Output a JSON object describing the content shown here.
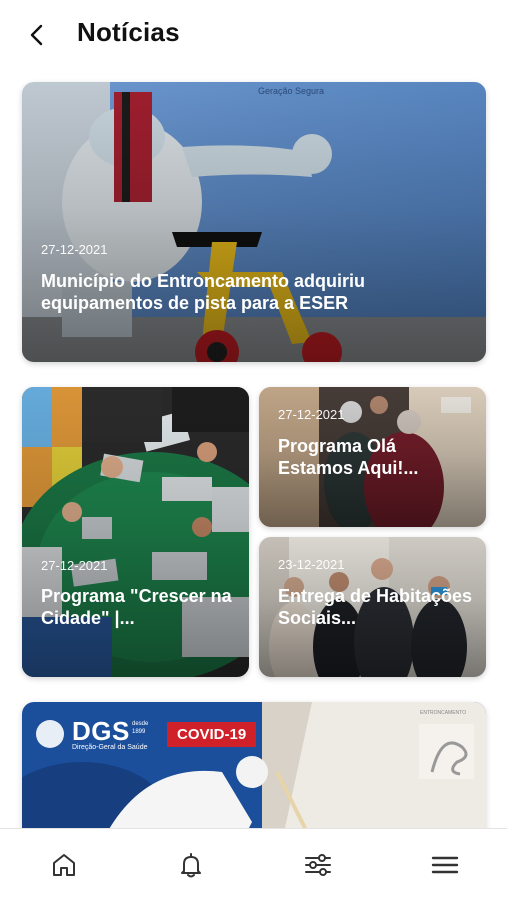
{
  "header": {
    "title": "Notícias"
  },
  "news": [
    {
      "date": "27-12-2021",
      "title": "Município do Entroncamento adquiriu equipamentos de pista para a ESER",
      "image_sign": "Geração Segura"
    },
    {
      "date": "27-12-2021",
      "title": "Programa \"Crescer na Cidade\" |..."
    },
    {
      "date": "27-12-2021",
      "title": "Programa Olá Estamos Aqui!..."
    },
    {
      "date": "23-12-2021",
      "title": "Entrega de Habitações Sociais..."
    },
    {
      "image_text": {
        "dgs": "DGS",
        "dgs_since": "desde 1899",
        "dgs_full": "Direção-Geral da Saúde",
        "covid": "COVID-19",
        "municipality": "ENTRONCAMENTO"
      }
    }
  ],
  "tabbar": {
    "items": [
      "home-icon",
      "bell-icon",
      "sliders-icon",
      "menu-icon"
    ]
  },
  "colors": {
    "accent_red": "#d0202a",
    "dgs_blue": "#1b4f9c"
  }
}
